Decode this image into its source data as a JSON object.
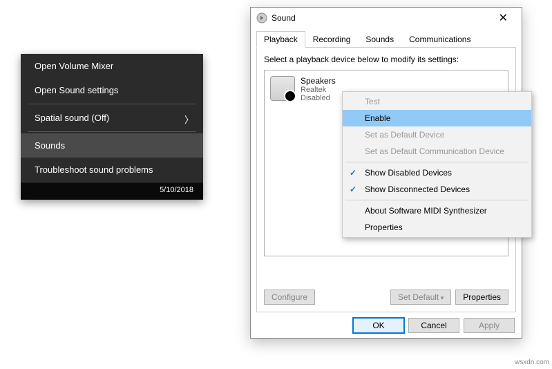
{
  "darkMenu": {
    "items": {
      "mixer": "Open Volume Mixer",
      "settings": "Open Sound settings",
      "spatial": "Spatial sound (Off)",
      "sounds": "Sounds",
      "troubleshoot": "Troubleshoot sound problems"
    },
    "date": "5/10/2018"
  },
  "dialog": {
    "title": "Sound",
    "tabs": {
      "playback": "Playback",
      "recording": "Recording",
      "sounds": "Sounds",
      "comm": "Communications"
    },
    "instruction": "Select a playback device below to modify its settings:",
    "device": {
      "name": "Speakers",
      "driver": "Realtek",
      "status": "Disabled"
    },
    "buttons": {
      "configure": "Configure",
      "setDefault": "Set Default",
      "properties": "Properties",
      "ok": "OK",
      "cancel": "Cancel",
      "apply": "Apply"
    }
  },
  "context": {
    "test": "Test",
    "enable": "Enable",
    "setDefault": "Set as Default Device",
    "setComm": "Set as Default Communication Device",
    "showDisabled": "Show Disabled Devices",
    "showDisconnected": "Show Disconnected Devices",
    "about": "About Software MIDI Synthesizer",
    "properties": "Properties"
  },
  "watermark": "wsxdn.com"
}
